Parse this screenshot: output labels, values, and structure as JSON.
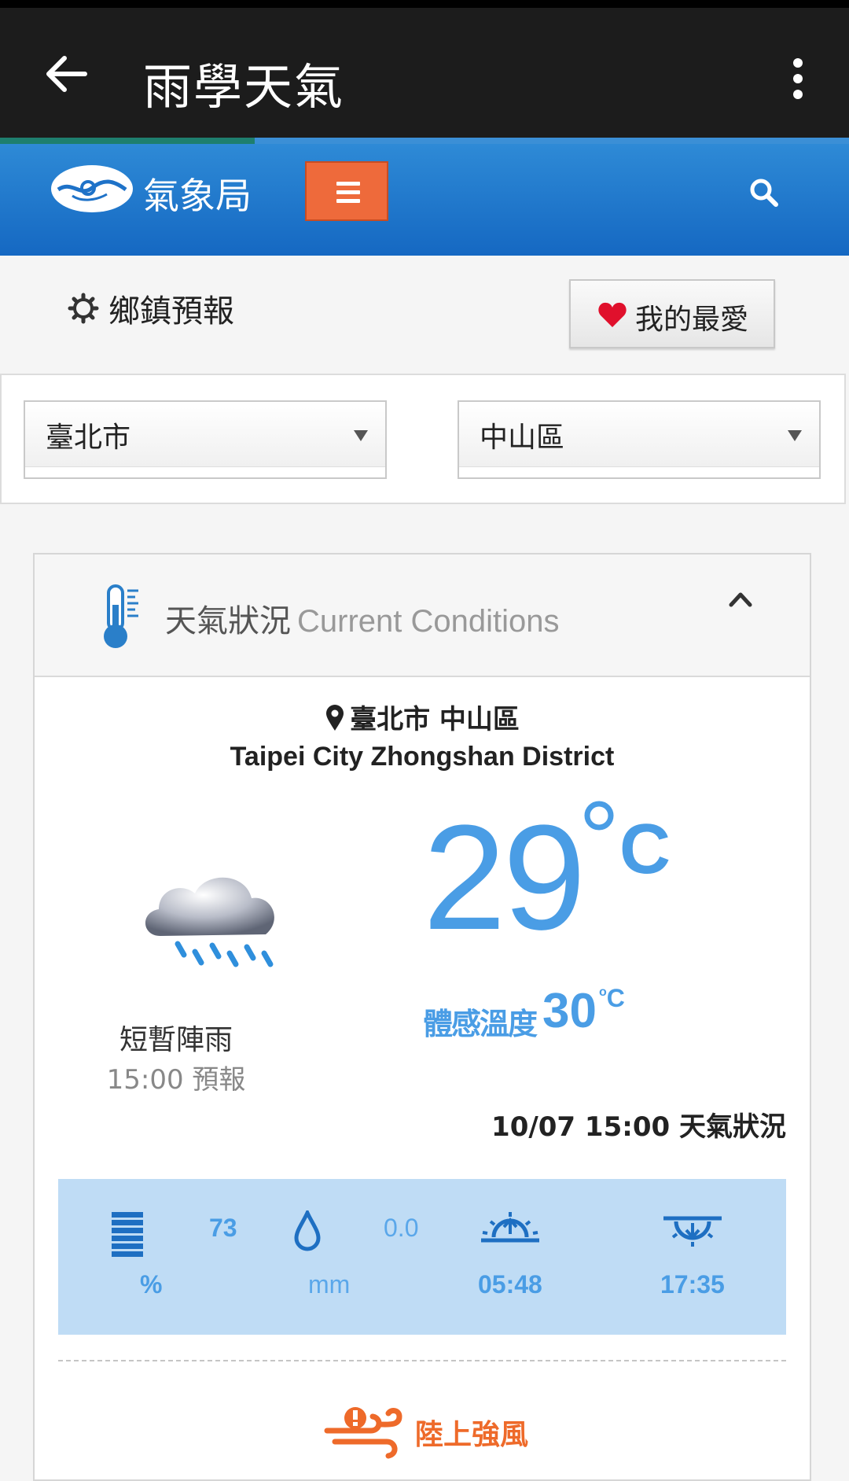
{
  "app_bar": {
    "title": "雨學天氣"
  },
  "site_header": {
    "name": "氣象局"
  },
  "section": {
    "title": "鄉鎮預報",
    "favorite_label": "我的最愛"
  },
  "selectors": {
    "city": "臺北市",
    "district": "中山區"
  },
  "card": {
    "title_zh": "天氣狀況",
    "title_en": "Current Conditions",
    "location_zh": "臺北市 中山區",
    "location_en": "Taipei City Zhongshan District",
    "condition": "短暫陣雨",
    "forecast_time": "15:00 預報",
    "temperature": "29",
    "temperature_unit": "C",
    "feels_like_label": "體感溫度",
    "feels_like_value": "30",
    "feels_like_unit": "C",
    "observation_time": "10/07 15:00 天氣狀況",
    "stats": {
      "humidity_value": "73",
      "humidity_unit": "%",
      "rain_value": "0.0",
      "rain_unit": "mm",
      "sunrise": "05:48",
      "sunset": "17:35"
    },
    "warning": "陸上強風"
  },
  "colors": {
    "app_bar": "#1c1c1c",
    "header_blue": "#1e72c8",
    "menu_orange": "#ee6a3b",
    "temp_blue": "#4a9de5",
    "stats_bg": "#bfdcf5",
    "warning_orange": "#ee6a2a"
  },
  "load_progress": 0.3
}
